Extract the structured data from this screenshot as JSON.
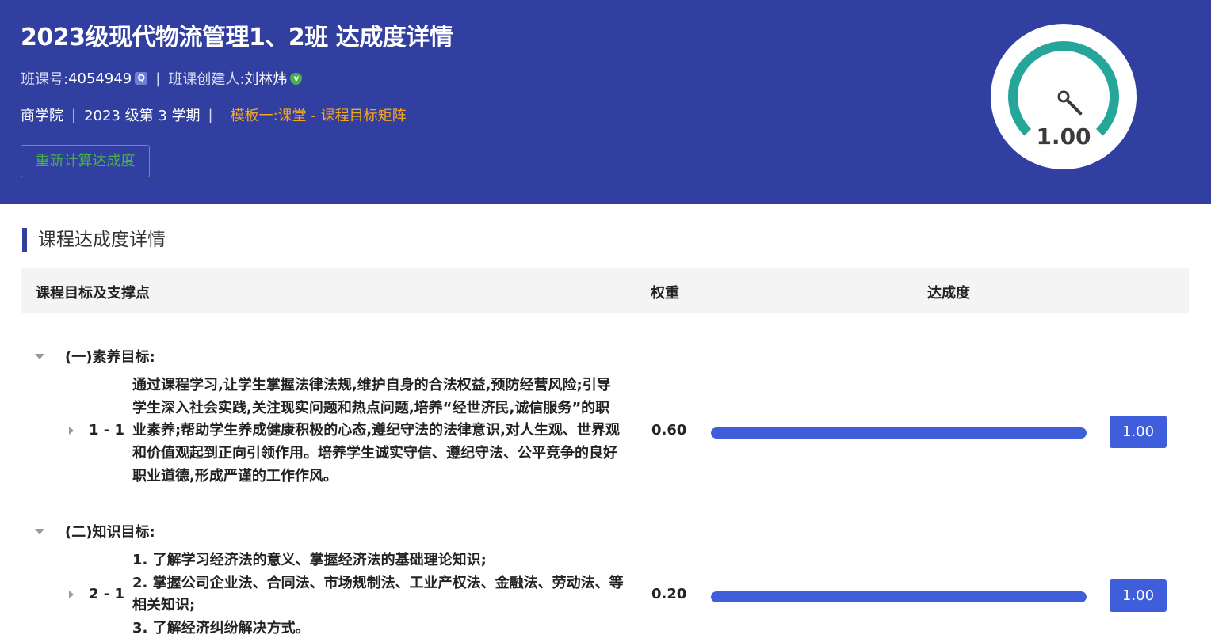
{
  "header": {
    "title": "2023级现代物流管理1、2班 达成度详情",
    "course_code_label": "班课号:",
    "course_code": "4054949",
    "creator_label": "班课创建人:",
    "creator": "刘林炜",
    "college": "商学院",
    "term": "2023 级第 3 学期",
    "template": "模板一:课堂 - 课程目标矩阵",
    "separator": "|",
    "recalc_button": "重新计算达成度"
  },
  "gauge": {
    "value": "1.00",
    "level": 1.0,
    "color": "#26a69a"
  },
  "section": {
    "title": "课程达成度详情"
  },
  "table": {
    "headers": [
      "课程目标及支撑点",
      "权重",
      "达成度"
    ],
    "groups": [
      {
        "title": "(一)素养目标:",
        "rows": [
          {
            "code": "1 - 1",
            "description": "通过课程学习,让学生掌握法律法规,维护自身的合法权益,预防经营风险;引导学生深入社会实践,关注现实问题和热点问题,培养“经世济民,诚信服务”的职业素养;帮助学生养成健康积极的心态,遵纪守法的法律意识,对人生观、世界观和价值观起到正向引领作用。培养学生诚实守信、遵纪守法、公平竞争的良好职业道德,形成严谨的工作作风。",
            "weight": "0.60",
            "progress": 1.0,
            "score": "1.00"
          }
        ]
      },
      {
        "title": "(二)知识目标:",
        "rows": [
          {
            "code": "2 - 1",
            "description_lines": [
              "1. 了解学习经济法的意义、掌握经济法的基础理论知识;",
              "2. 掌握公司企业法、合同法、市场规制法、工业产权法、金融法、劳动法、等相关知识;",
              "3. 了解经济纠纷解决方式。"
            ],
            "weight": "0.20",
            "progress": 1.0,
            "score": "1.00"
          }
        ]
      }
    ]
  },
  "colors": {
    "header_bg": "#313fa0",
    "accent": "#3e5edc",
    "button_green": "#4caf50",
    "template_orange": "#f5a623"
  }
}
